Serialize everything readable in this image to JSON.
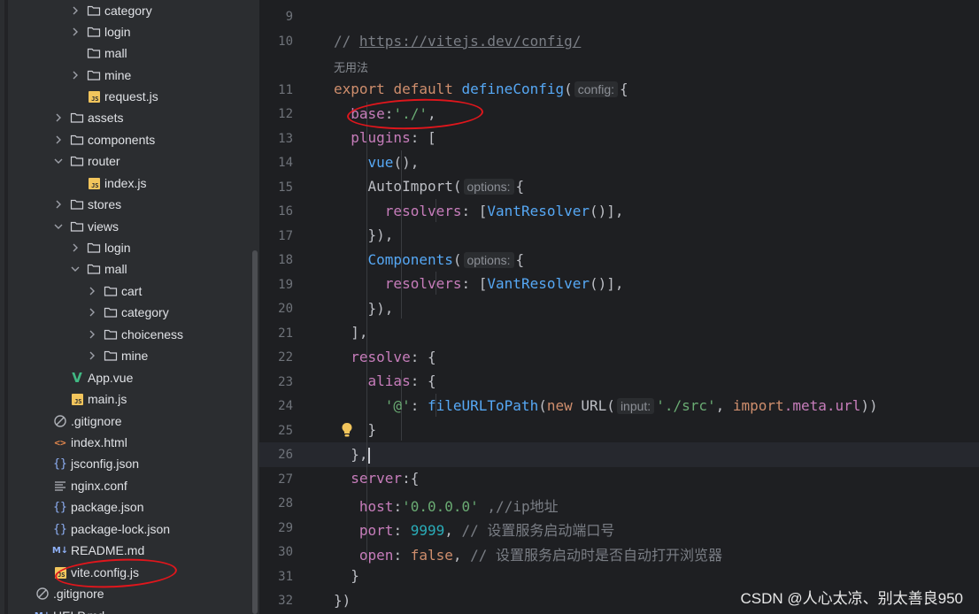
{
  "sidebar": {
    "items": [
      {
        "label": "category",
        "icon": "folder-icon",
        "chevron": "right"
      },
      {
        "label": "login",
        "icon": "folder-icon",
        "chevron": "right"
      },
      {
        "label": "mall",
        "icon": "folder-icon",
        "chevron": "none"
      },
      {
        "label": "mine",
        "icon": "folder-icon",
        "chevron": "right"
      },
      {
        "label": "request.js",
        "icon": "js-file-icon",
        "chevron": "none"
      },
      {
        "label": "assets",
        "icon": "folder-icon",
        "chevron": "right"
      },
      {
        "label": "components",
        "icon": "folder-icon",
        "chevron": "right"
      },
      {
        "label": "router",
        "icon": "folder-icon",
        "chevron": "down"
      },
      {
        "label": "index.js",
        "icon": "js-file-icon",
        "chevron": "none"
      },
      {
        "label": "stores",
        "icon": "folder-icon",
        "chevron": "right"
      },
      {
        "label": "views",
        "icon": "folder-icon",
        "chevron": "down"
      },
      {
        "label": "login",
        "icon": "folder-icon",
        "chevron": "right"
      },
      {
        "label": "mall",
        "icon": "folder-icon",
        "chevron": "down"
      },
      {
        "label": "cart",
        "icon": "folder-icon",
        "chevron": "right"
      },
      {
        "label": "category",
        "icon": "folder-icon",
        "chevron": "right"
      },
      {
        "label": "choiceness",
        "icon": "folder-icon",
        "chevron": "right"
      },
      {
        "label": "mine",
        "icon": "folder-icon",
        "chevron": "right"
      },
      {
        "label": "App.vue",
        "icon": "vue-file-icon",
        "chevron": "none"
      },
      {
        "label": "main.js",
        "icon": "js-file-icon",
        "chevron": "none"
      },
      {
        "label": ".gitignore",
        "icon": "ignore-file-icon",
        "chevron": "none"
      },
      {
        "label": "index.html",
        "icon": "html-file-icon",
        "chevron": "none"
      },
      {
        "label": "jsconfig.json",
        "icon": "json-file-icon",
        "chevron": "none"
      },
      {
        "label": "nginx.conf",
        "icon": "config-file-icon",
        "chevron": "none"
      },
      {
        "label": "package.json",
        "icon": "json-file-icon",
        "chevron": "none"
      },
      {
        "label": "package-lock.json",
        "icon": "json-file-icon",
        "chevron": "none"
      },
      {
        "label": "README.md",
        "icon": "markdown-file-icon",
        "chevron": "none"
      },
      {
        "label": "vite.config.js",
        "icon": "js-file-icon",
        "chevron": "none"
      },
      {
        "label": ".gitignore",
        "icon": "ignore-file-icon",
        "chevron": "none"
      },
      {
        "label": "HELP.md",
        "icon": "markdown-file-icon",
        "chevron": "none"
      }
    ]
  },
  "editor": {
    "line_numbers": [
      "9",
      "10",
      "11",
      "12",
      "13",
      "14",
      "15",
      "16",
      "17",
      "18",
      "19",
      "20",
      "21",
      "22",
      "23",
      "24",
      "25",
      "26",
      "27",
      "28",
      "29",
      "30",
      "31",
      "32"
    ],
    "inlay_text": "无用法",
    "url_comment_prefix": "// ",
    "url": "https://vitejs.dev/config/",
    "kw_export": "export",
    "kw_default": "default",
    "fn_defineConfig": "defineConfig",
    "hint_config": "config:",
    "prop_base": "base",
    "str_base": "'./'",
    "prop_plugins": "plugins",
    "fn_vue": "vue",
    "fn_autoimport": "AutoImport",
    "hint_options": "options:",
    "prop_resolvers": "resolvers",
    "fn_vantresolver": "VantResolver",
    "fn_components": "Components",
    "prop_resolve": "resolve",
    "prop_alias": "alias",
    "str_at": "'@'",
    "fn_fileurltopath": "fileURLToPath",
    "kw_new": "new",
    "url_class": "URL",
    "hint_input": "input:",
    "str_src": "'./src'",
    "kw_import": "import",
    "meta_url": ".meta.url",
    "prop_server": "server",
    "prop_host": "host",
    "str_host": "'0.0.0.0'",
    "cmt_host": ",//ip地址",
    "prop_port": "port",
    "num_port": "9999",
    "cmt_port": "// 设置服务启动端口号",
    "prop_open": "open",
    "kw_false": "false",
    "cmt_open": "// 设置服务启动时是否自动打开浏览器"
  },
  "watermark": "CSDN @人心太凉、别太善良950",
  "colors": {
    "sidebar_bg": "#2b2d30",
    "editor_bg": "#1e1f22",
    "keyword": "#cf8e6d",
    "function": "#56a8f5",
    "property": "#c77dbb",
    "string": "#6aab73",
    "number": "#2aacb8",
    "comment": "#7a7e85",
    "annotation_red": "#e0161c"
  }
}
